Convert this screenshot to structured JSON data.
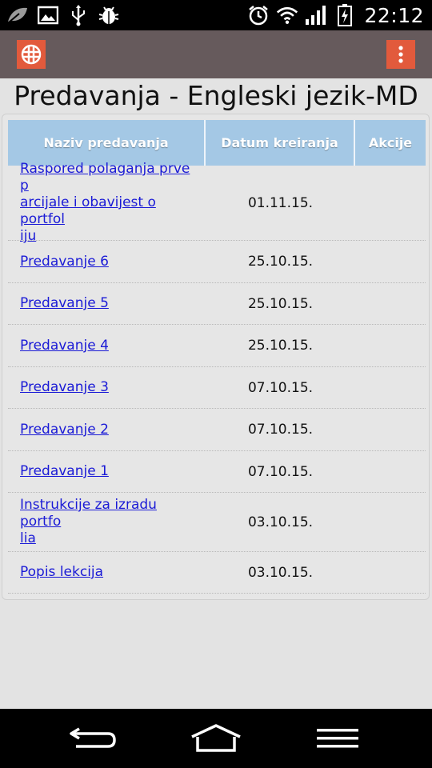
{
  "status_bar": {
    "time": "22:12",
    "left_icons": [
      "leaf-icon",
      "image-icon",
      "usb-icon",
      "bug-icon"
    ],
    "right_icons": [
      "alarm-icon",
      "wifi-icon",
      "signal-icon",
      "battery-charging-icon"
    ]
  },
  "action_bar": {
    "left_icon": "grid-globe-icon",
    "right_icon": "overflow-menu-icon",
    "accent_color": "#e25a3c",
    "bar_color": "#665a5c"
  },
  "page": {
    "title": "Predavanja - Engleski jezik-MD"
  },
  "table": {
    "header_color": "#a4c8e5",
    "link_color": "#1a1ad6",
    "columns": [
      "Naziv predavanja",
      "Datum kreiranja",
      "Akcije"
    ],
    "rows": [
      {
        "name_lines": [
          "Raspored polaganja prve p",
          "arcijale i obavijest o portfol",
          "iju"
        ],
        "date": "01.11.15."
      },
      {
        "name_lines": [
          "Predavanje 6"
        ],
        "date": "25.10.15."
      },
      {
        "name_lines": [
          "Predavanje 5"
        ],
        "date": "25.10.15."
      },
      {
        "name_lines": [
          "Predavanje 4"
        ],
        "date": "25.10.15."
      },
      {
        "name_lines": [
          "Predavanje 3"
        ],
        "date": "07.10.15."
      },
      {
        "name_lines": [
          "Predavanje 2"
        ],
        "date": "07.10.15."
      },
      {
        "name_lines": [
          "Predavanje 1"
        ],
        "date": "07.10.15."
      },
      {
        "name_lines": [
          "Instrukcije za izradu portfo",
          "lia"
        ],
        "date": "03.10.15."
      },
      {
        "name_lines": [
          "Popis lekcija"
        ],
        "date": "03.10.15."
      }
    ]
  },
  "nav_bar": {
    "icons": [
      "back-icon",
      "home-icon",
      "menu-icon"
    ]
  }
}
